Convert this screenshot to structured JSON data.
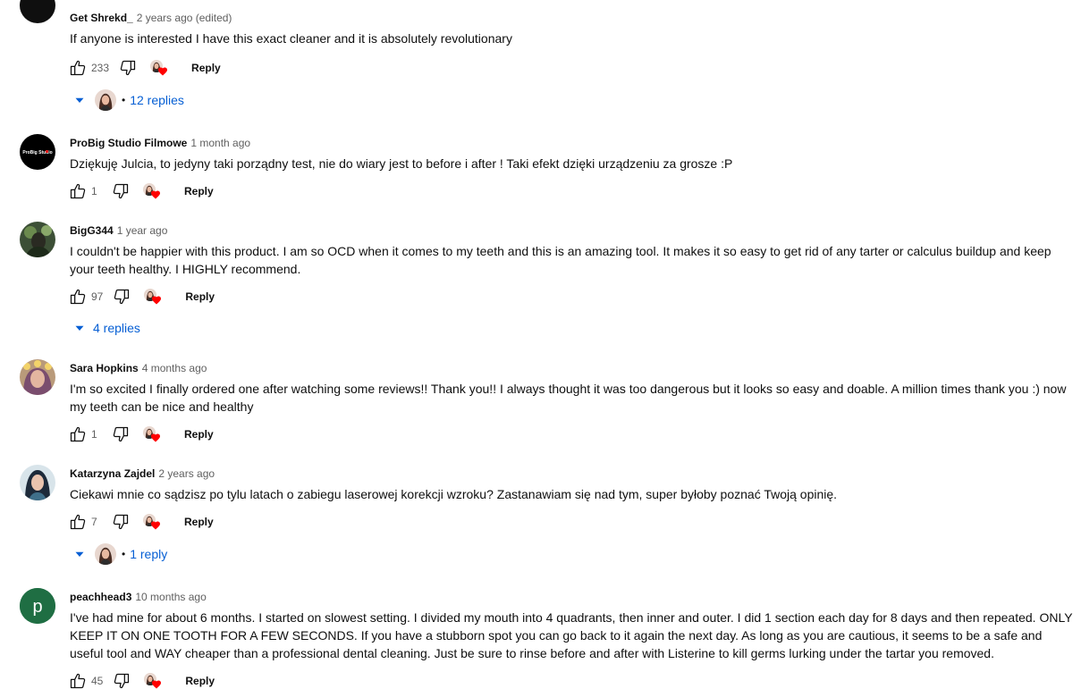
{
  "comments": [
    {
      "author": "Get Shrekd_",
      "time": "2 years ago (edited)",
      "text": "If anyone is interested I have this exact cleaner and it is absolutely revolutionary",
      "likes": "233",
      "reply_label": "Reply",
      "replies": "12 replies"
    },
    {
      "author": "ProBig Studio Filmowe",
      "time": "1 month ago",
      "text": "Dziękuję Julcia, to jedyny taki porządny test, nie do wiary jest to before i after ! Taki efekt dzięki urządzeniu za grosze :P",
      "likes": "1",
      "reply_label": "Reply",
      "avatar_text": "ProBig Studio"
    },
    {
      "author": "BigG344",
      "time": "1 year ago",
      "text": "I couldn't be happier with this product. I am so OCD when it comes to my teeth and this is an amazing tool. It makes it so easy to get rid of any tarter or calculus buildup and keep your teeth healthy. I HIGHLY recommend.",
      "likes": "97",
      "reply_label": "Reply",
      "replies": "4 replies"
    },
    {
      "author": "Sara Hopkins",
      "time": "4 months ago",
      "text": "I'm so excited I finally ordered one after watching some reviews!! Thank you!! I always thought it was too dangerous but it looks so easy and doable. A million times thank you :) now my teeth can be nice and healthy",
      "likes": "1",
      "reply_label": "Reply"
    },
    {
      "author": "Katarzyna Zajdel",
      "time": "2 years ago",
      "text": "Ciekawi mnie co sądzisz po tylu latach o zabiegu laserowej korekcji wzroku? Zastanawiam się nad tym, super byłoby poznać Twoją opinię.",
      "likes": "7",
      "reply_label": "Reply",
      "replies": "1 reply"
    },
    {
      "author": "peachhead3",
      "time": "10 months ago",
      "text": "I've had mine for about 6 months. I started on slowest setting. I divided my mouth into 4 quadrants, then inner and outer. I did 1 section each day for 8 days and then repeated. ONLY KEEP IT ON ONE TOOTH FOR A FEW SECONDS. If you have a stubborn spot you can go back to it again the next day. As long as you are cautious, it seems to be a safe and useful tool and WAY cheaper than a professional dental cleaning. Just be sure to rinse before and after with Listerine to kill germs lurking under the tartar you removed.",
      "likes": "45",
      "reply_label": "Reply",
      "avatar_letter": "p"
    }
  ],
  "colors": {
    "link_blue": "#065fd4",
    "heart_red": "#ff0000",
    "peach_avatar": "#1f6e43",
    "meta_gray": "#606060"
  },
  "icons": {
    "like": "thumb-up-icon",
    "dislike": "thumb-down-icon",
    "heart": "creator-heart-icon",
    "expand": "caret-down-icon"
  }
}
